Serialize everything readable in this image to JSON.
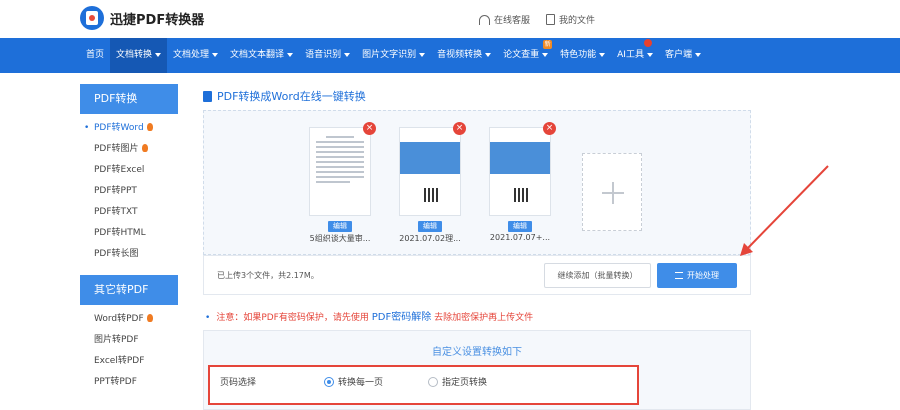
{
  "header": {
    "logo_text": "迅捷PDF转换器",
    "links": [
      {
        "label": "在线客服",
        "icon": "headset-icon"
      },
      {
        "label": "我的文件",
        "icon": "file-icon"
      }
    ]
  },
  "nav": {
    "items": [
      {
        "label": "首页",
        "caret": false,
        "active": false
      },
      {
        "label": "文档转换",
        "caret": true,
        "active": true
      },
      {
        "label": "文档处理",
        "caret": true,
        "active": false
      },
      {
        "label": "文档文本翻译",
        "caret": true,
        "active": false
      },
      {
        "label": "语音识别",
        "caret": true,
        "active": false
      },
      {
        "label": "图片文字识别",
        "caret": true,
        "active": false
      },
      {
        "label": "音视频转换",
        "caret": true,
        "active": false
      },
      {
        "label": "论文查重",
        "caret": true,
        "active": false,
        "badge": "新"
      },
      {
        "label": "特色功能",
        "caret": true,
        "active": false
      },
      {
        "label": "AI工具",
        "caret": true,
        "active": false,
        "badge_red": true
      },
      {
        "label": "客户端",
        "caret": true,
        "active": false
      }
    ]
  },
  "sidebar": {
    "section1_title": "PDF转换",
    "section1_items": [
      {
        "label": "PDF转Word",
        "hot": true,
        "active": true
      },
      {
        "label": "PDF转图片",
        "hot": true,
        "active": false
      },
      {
        "label": "PDF转Excel",
        "hot": false,
        "active": false
      },
      {
        "label": "PDF转PPT",
        "hot": false,
        "active": false
      },
      {
        "label": "PDF转TXT",
        "hot": false,
        "active": false
      },
      {
        "label": "PDF转HTML",
        "hot": false,
        "active": false
      },
      {
        "label": "PDF转长图",
        "hot": false,
        "active": false
      }
    ],
    "section2_title": "其它转PDF",
    "section2_items": [
      {
        "label": "Word转PDF",
        "hot": true
      },
      {
        "label": "图片转PDF",
        "hot": false
      },
      {
        "label": "Excel转PDF",
        "hot": false
      },
      {
        "label": "PPT转PDF",
        "hot": false
      }
    ]
  },
  "main": {
    "title": "PDF转换成Word在线一键转换",
    "files": [
      {
        "name": "5组织谈大量审...",
        "edit_label": "编辑",
        "kind": "text"
      },
      {
        "name": "2021.07.02理...",
        "edit_label": "编辑",
        "kind": "banner"
      },
      {
        "name": "2021.07.07+...",
        "edit_label": "编辑",
        "kind": "banner"
      }
    ],
    "uploaded_text": "已上传3个文件，共2.17M。",
    "continue_label": "继续添加（批量转换）",
    "start_label": "开始处理",
    "notice_prefix": "注意：如果PDF有密码保护，请先使用",
    "notice_link": "PDF密码解除",
    "notice_suffix": "去除加密保护再上传文件",
    "settings_title": "自定义设置转换如下",
    "page_select_label": "页码选择",
    "radio_each": "转换每一页",
    "radio_specified": "指定页转换"
  },
  "colors": {
    "primary": "#1e6fd9",
    "accent": "#3f8de8",
    "warning": "#e5453a"
  }
}
